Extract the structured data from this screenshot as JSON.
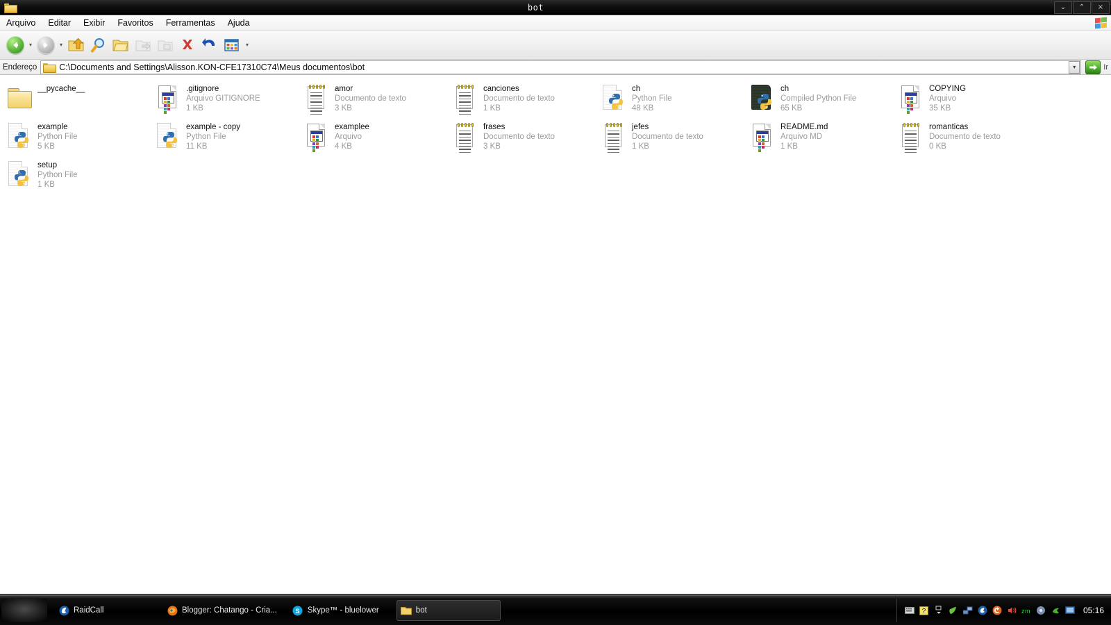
{
  "window": {
    "title": "bot",
    "controls": [
      {
        "name": "minimize",
        "glyph": "⌄"
      },
      {
        "name": "maximize",
        "glyph": "⌃"
      },
      {
        "name": "close",
        "glyph": "×"
      }
    ]
  },
  "menubar": {
    "items": [
      "Arquivo",
      "Editar",
      "Exibir",
      "Favoritos",
      "Ferramentas",
      "Ajuda"
    ],
    "logo": "windows-flag-icon"
  },
  "toolbar": {
    "buttons": [
      {
        "name": "back-button",
        "icon": "back-arrow-icon",
        "enabled": true
      },
      {
        "name": "forward-button",
        "icon": "forward-arrow-icon",
        "enabled": false
      },
      {
        "name": "up-button",
        "icon": "folder-up-icon",
        "enabled": true
      },
      {
        "name": "search-button",
        "icon": "search-icon",
        "enabled": true
      },
      {
        "name": "folders-button",
        "icon": "folders-icon",
        "enabled": true
      },
      {
        "name": "move-to-button",
        "icon": "move-to-folder-icon",
        "enabled": false
      },
      {
        "name": "copy-to-button",
        "icon": "copy-to-folder-icon",
        "enabled": false
      },
      {
        "name": "delete-button",
        "icon": "delete-x-icon",
        "enabled": true
      },
      {
        "name": "undo-button",
        "icon": "undo-arrow-icon",
        "enabled": true
      },
      {
        "name": "views-button",
        "icon": "views-grid-icon",
        "enabled": true
      }
    ]
  },
  "addressbar": {
    "label": "Endereço",
    "path": "C:\\Documents and Settings\\Alisson.KON-CFE17310C74\\Meus documentos\\bot",
    "go_label": "Ir",
    "dropdown_glyph": "▾"
  },
  "files": [
    {
      "name": "__pycache__",
      "type": "",
      "size": "",
      "icon": "folder-icon"
    },
    {
      "name": ".gitignore",
      "type": "Arquivo GITIGNORE",
      "size": "1 KB",
      "icon": "generic-file-icon"
    },
    {
      "name": "amor",
      "type": "Documento de texto",
      "size": "3 KB",
      "icon": "text-document-icon"
    },
    {
      "name": "canciones",
      "type": "Documento de texto",
      "size": "1 KB",
      "icon": "text-document-icon"
    },
    {
      "name": "ch",
      "type": "Python File",
      "size": "48 KB",
      "icon": "python-file-icon"
    },
    {
      "name": "ch",
      "type": "Compiled Python File",
      "size": "65 KB",
      "icon": "compiled-python-file-icon"
    },
    {
      "name": "COPYING",
      "type": "Arquivo",
      "size": "35 KB",
      "icon": "generic-file-icon"
    },
    {
      "name": "example",
      "type": "Python File",
      "size": "5 KB",
      "icon": "python-file-icon"
    },
    {
      "name": "example - copy",
      "type": "Python File",
      "size": "11 KB",
      "icon": "python-file-icon"
    },
    {
      "name": "examplee",
      "type": "Arquivo",
      "size": "4 KB",
      "icon": "generic-file-icon"
    },
    {
      "name": "frases",
      "type": "Documento de texto",
      "size": "3 KB",
      "icon": "text-document-icon"
    },
    {
      "name": "jefes",
      "type": "Documento de texto",
      "size": "1 KB",
      "icon": "text-document-icon"
    },
    {
      "name": "README.md",
      "type": "Arquivo MD",
      "size": "1 KB",
      "icon": "generic-file-icon"
    },
    {
      "name": "romanticas",
      "type": "Documento de texto",
      "size": "0 KB",
      "icon": "text-document-icon"
    },
    {
      "name": "setup",
      "type": "Python File",
      "size": "1 KB",
      "icon": "python-file-icon"
    }
  ],
  "taskbar": {
    "start_label": "",
    "tasks": [
      {
        "label": "RaidCall",
        "icon": "raidcall-icon",
        "active": false
      },
      {
        "label": "Blogger: Chatango - Cria...",
        "icon": "firefox-icon",
        "active": false
      },
      {
        "label": "Skype™ - bluelower",
        "icon": "skype-icon",
        "active": false
      },
      {
        "label": "bot",
        "icon": "folder-icon",
        "active": true
      }
    ],
    "tray": {
      "icons": [
        "keyboard-icon",
        "help-icon",
        "show-hidden-icon",
        "shield-green-icon",
        "network-icon",
        "raidcall-tray-icon",
        "update-icon",
        "volume-icon",
        "zoom-icon",
        "media-icon",
        "sync-icon",
        "monitor-icon"
      ],
      "clock": "05:16"
    }
  },
  "colors": {
    "accent_green": "#4fae2e",
    "delete_red": "#d23a30",
    "undo_blue": "#1c4fb5",
    "folder_yellow": "#f3d16a",
    "taskbar_black": "#000000",
    "text_grey": "#9b9b9b"
  }
}
